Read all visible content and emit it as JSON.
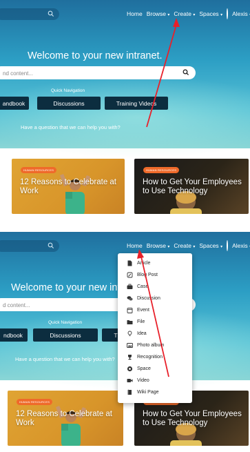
{
  "nav": {
    "home": "Home",
    "browse": "Browse",
    "create": "Create",
    "spaces": "Spaces",
    "user": "Alexis",
    "caret": "▾"
  },
  "hero": {
    "welcome_top": "Welcome to your new intranet.",
    "welcome_bottom": "Welcome to your new intranet",
    "search_placeholder_top": "nd content...",
    "search_placeholder_bottom": "d content...",
    "quick_navigation": "Quick Navigation",
    "buttons_top": [
      "andbook",
      "Discussions",
      "Training Videos"
    ],
    "buttons_bottom": [
      "ndbook",
      "Discussions",
      "T"
    ],
    "question": "Have a question that we can help you with?"
  },
  "cards": [
    {
      "tag": "HUMAN RESOURCES",
      "title": "12 Reasons to Celebrate at Work"
    },
    {
      "tag": "HUMAN RESOURCES",
      "title": "How to Get Your Employees to Use Technology"
    }
  ],
  "create_menu": {
    "items": [
      {
        "label": "Article",
        "icon": "article-icon"
      },
      {
        "label": "Blog Post",
        "icon": "blog-post-icon"
      },
      {
        "label": "Case",
        "icon": "case-icon"
      },
      {
        "label": "Discussion",
        "icon": "discussion-icon"
      },
      {
        "label": "Event",
        "icon": "event-icon"
      },
      {
        "label": "File",
        "icon": "file-icon"
      },
      {
        "label": "Idea",
        "icon": "idea-icon"
      },
      {
        "label": "Photo album",
        "icon": "photo-album-icon"
      },
      {
        "label": "Recognition",
        "icon": "recognition-icon"
      },
      {
        "label": "Space",
        "icon": "space-icon"
      },
      {
        "label": "Video",
        "icon": "video-icon"
      },
      {
        "label": "Wiki Page",
        "icon": "wiki-page-icon"
      }
    ]
  },
  "colors": {
    "annotation_arrow": "#e8202a",
    "button_dark": "#0c2d3f",
    "tag_orange": "#ef6a2a"
  }
}
